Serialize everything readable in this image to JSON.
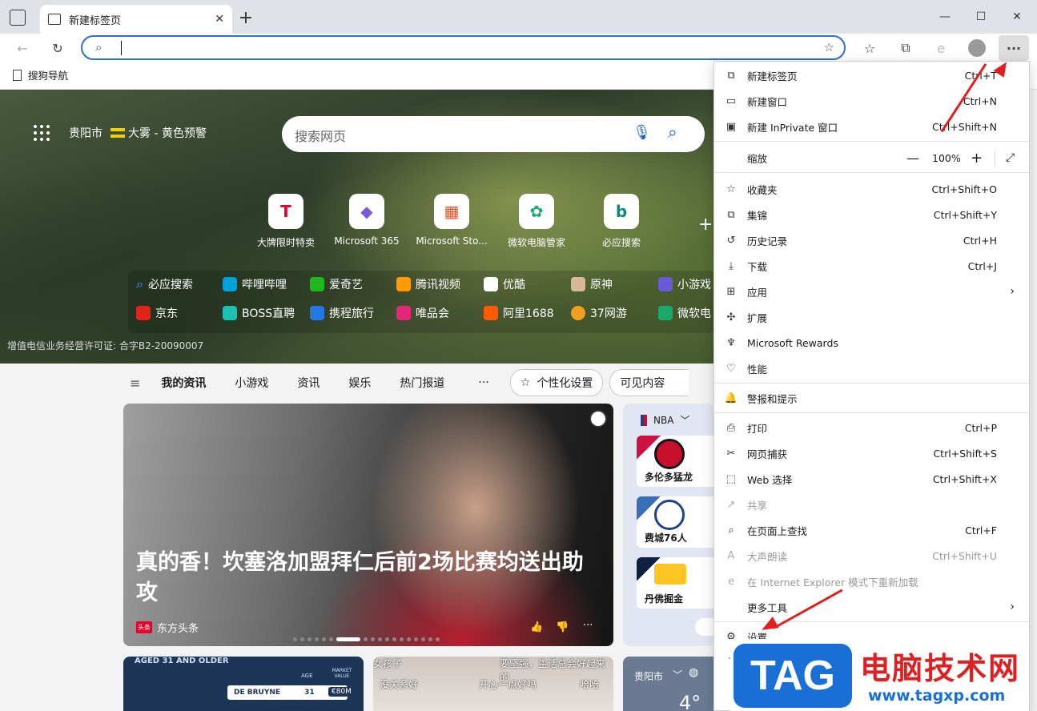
{
  "window": {
    "tab_title": "新建标签页"
  },
  "favorites": {
    "item": "搜狗导航"
  },
  "hero": {
    "city": "贵阳市",
    "weather": "大雾 - 黄色预警",
    "search_placeholder": "搜索网页",
    "license": "增值电信业务经营许可证: 合字B2-20090007"
  },
  "tiles": [
    {
      "label": "大牌限时特卖",
      "glyph": "T",
      "color": "#e4002b"
    },
    {
      "label": "Microsoft 365",
      "glyph": "◆",
      "color": "#7b5cd6"
    },
    {
      "label": "Microsoft Sto...",
      "glyph": "▦",
      "color": "#f25022"
    },
    {
      "label": "微软电脑管家",
      "glyph": "✿",
      "color": "#1aa86b"
    },
    {
      "label": "必应搜索",
      "glyph": "b",
      "color": "#0f8a7a"
    }
  ],
  "links_row1": [
    "必应搜索",
    "哔哩哔哩",
    "爱奇艺",
    "腾讯视频",
    "优酷",
    "原神",
    "小游戏"
  ],
  "links_row2": [
    "京东",
    "BOSS直聘",
    "携程旅行",
    "唯品会",
    "阿里1688",
    "37网游",
    "微软电"
  ],
  "news_tabs": [
    "我的资讯",
    "小游戏",
    "资讯",
    "娱乐",
    "热门报道",
    "···"
  ],
  "news_pills": {
    "personalize": "个性化设置",
    "visible": "可见内容"
  },
  "headline": {
    "title": "真的香！坎塞洛加盟拜仁后前2场比赛均送出助攻",
    "source": "东方头条",
    "source_badge": "头条"
  },
  "nba": {
    "label": "NBA",
    "teams": [
      "多伦多猛龙",
      "费城76人",
      "丹佛掘金"
    ]
  },
  "bottom": {
    "card1_text": "AGED 31 AND OLDER",
    "card1_player": "DE BRUYNE",
    "card1_age_hdr": "AGE",
    "card1_mv_hdr": "MARKET VALUE",
    "card1_age": "31",
    "card1_value": "€80M",
    "card2_a": "女孩子",
    "card2_b": "要坚强，生活总会好起来的",
    "card2_c": "没关系好",
    "card2_d": "开心一点好吗",
    "card2_e": "哈哈",
    "weather_city": "贵阳市",
    "weather_temp": "4°"
  },
  "menu": {
    "new_tab": "新建标签页",
    "new_tab_sc": "Ctrl+T",
    "new_window": "新建窗口",
    "new_window_sc": "Ctrl+N",
    "inprivate": "新建 InPrivate 窗口",
    "inprivate_sc": "Ctrl+Shift+N",
    "zoom": "缩放",
    "zoom_value": "100%",
    "favorites": "收藏夹",
    "favorites_sc": "Ctrl+Shift+O",
    "collections": "集锦",
    "collections_sc": "Ctrl+Shift+Y",
    "history": "历史记录",
    "history_sc": "Ctrl+H",
    "downloads": "下载",
    "downloads_sc": "Ctrl+J",
    "apps": "应用",
    "extensions": "扩展",
    "rewards": "Microsoft Rewards",
    "performance": "性能",
    "alerts": "警报和提示",
    "print": "打印",
    "print_sc": "Ctrl+P",
    "capture": "网页捕获",
    "capture_sc": "Ctrl+Shift+S",
    "web_select": "Web 选择",
    "web_select_sc": "Ctrl+Shift+X",
    "share": "共享",
    "find": "在页面上查找",
    "find_sc": "Ctrl+F",
    "read_aloud": "大声朗读",
    "read_aloud_sc": "Ctrl+Shift+U",
    "ie_mode": "在 Internet Explorer 模式下重新加载",
    "more_tools": "更多工具",
    "settings": "设置"
  },
  "watermark": {
    "tag": "TAG",
    "title": "电脑技术网",
    "url": "www.tagxp.com"
  },
  "colors": {
    "accent": "#2f6fd0",
    "arrow": "#e02020",
    "watermark": "#1a6fd6"
  }
}
